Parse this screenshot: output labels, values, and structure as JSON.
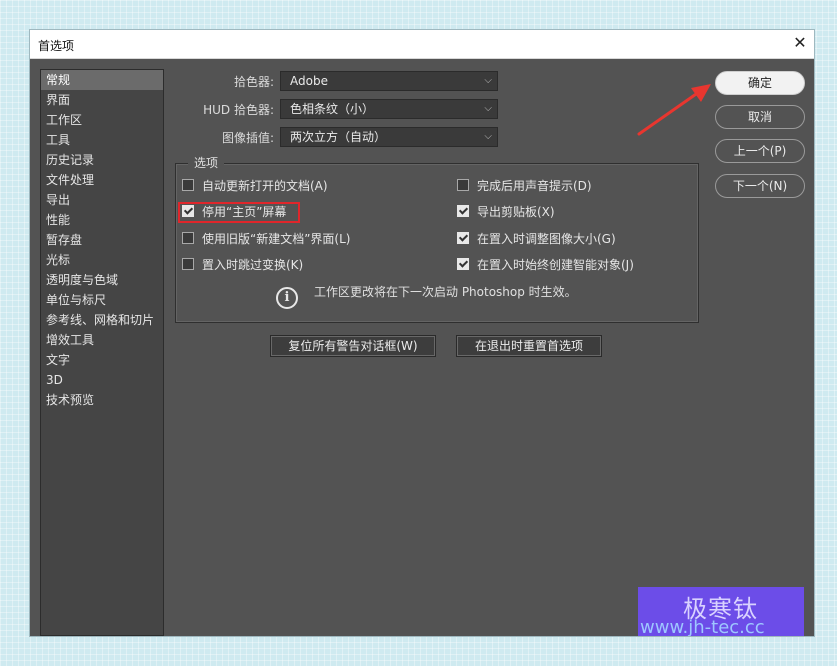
{
  "window": {
    "title": "首选项"
  },
  "sidebar": {
    "items": [
      {
        "label": "常规",
        "active": true
      },
      {
        "label": "界面"
      },
      {
        "label": "工作区"
      },
      {
        "label": "工具"
      },
      {
        "label": "历史记录"
      },
      {
        "label": "文件处理"
      },
      {
        "label": "导出"
      },
      {
        "label": "性能"
      },
      {
        "label": "暂存盘"
      },
      {
        "label": "光标"
      },
      {
        "label": "透明度与色域"
      },
      {
        "label": "单位与标尺"
      },
      {
        "label": "参考线、网格和切片"
      },
      {
        "label": "增效工具"
      },
      {
        "label": "文字"
      },
      {
        "label": "3D"
      },
      {
        "label": "技术预览"
      }
    ]
  },
  "fields": {
    "color_picker": {
      "label": "拾色器:",
      "value": "Adobe"
    },
    "hud_color_picker": {
      "label": "HUD 拾色器:",
      "value": "色相条纹（小）"
    },
    "image_interpolation": {
      "label": "图像插值:",
      "value": "两次立方（自动）"
    }
  },
  "options": {
    "legend": "选项",
    "auto_update": {
      "label": "自动更新打开的文档(A)",
      "checked": false
    },
    "disable_home": {
      "label": "停用“主页”屏幕",
      "checked": true
    },
    "legacy_new_doc": {
      "label": "使用旧版“新建文档”界面(L)",
      "checked": false
    },
    "skip_transform": {
      "label": "置入时跳过变换(K)",
      "checked": false
    },
    "beep": {
      "label": "完成后用声音提示(D)",
      "checked": false
    },
    "export_clipboard": {
      "label": "导出剪贴板(X)",
      "checked": true
    },
    "resize_on_place": {
      "label": "在置入时调整图像大小(G)",
      "checked": true
    },
    "smart_object": {
      "label": "在置入时始终创建智能对象(J)",
      "checked": true
    },
    "info": "工作区更改将在下一次启动 Photoshop 时生效。"
  },
  "buttons": {
    "reset_warnings": "复位所有警告对话框(W)",
    "reset_on_quit": "在退出时重置首选项",
    "ok": "确定",
    "cancel": "取消",
    "prev": "上一个(P)",
    "next": "下一个(N)"
  },
  "watermark": {
    "title": "极寒钛",
    "url": "www.jh-tec.cc"
  },
  "colors": {
    "panel": "#535353",
    "highlight": "#e0262b",
    "arrow": "#e8362f",
    "watermark_bg": "#6c4de8"
  }
}
